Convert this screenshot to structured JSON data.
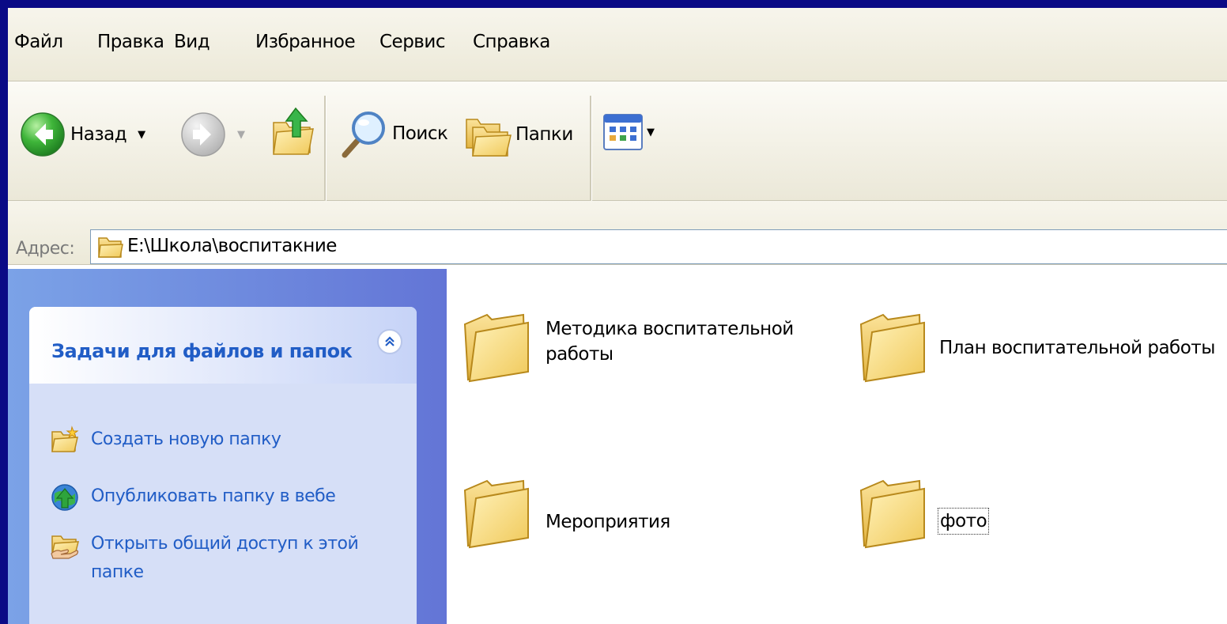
{
  "menu": {
    "items": [
      "Файл",
      "Правка",
      "Вид",
      "Избранное",
      "Сервис",
      "Справка"
    ]
  },
  "toolbar": {
    "back_label": "Назад",
    "search_label": "Поиск",
    "folders_label": "Папки"
  },
  "address": {
    "label": "Адрес:",
    "path": "E:\\Школа\\воспитакние"
  },
  "tasks": {
    "title": "Задачи для файлов и папок",
    "items": [
      {
        "label": "Создать новую папку",
        "icon": "new-folder-icon"
      },
      {
        "label": "Опубликовать папку в вебе",
        "icon": "publish-web-icon"
      },
      {
        "label": "Открыть общий доступ к этой папке",
        "icon": "share-folder-icon"
      }
    ]
  },
  "folders": [
    {
      "name": "Методика воспитательной работы"
    },
    {
      "name": "План воспитательной работы"
    },
    {
      "name": "Мероприятия"
    },
    {
      "name": "фото"
    }
  ],
  "colors": {
    "background": "#0a0a86",
    "link": "#215dc6",
    "sidebar": "#7ba2e7",
    "folder": "#f6d36b"
  }
}
